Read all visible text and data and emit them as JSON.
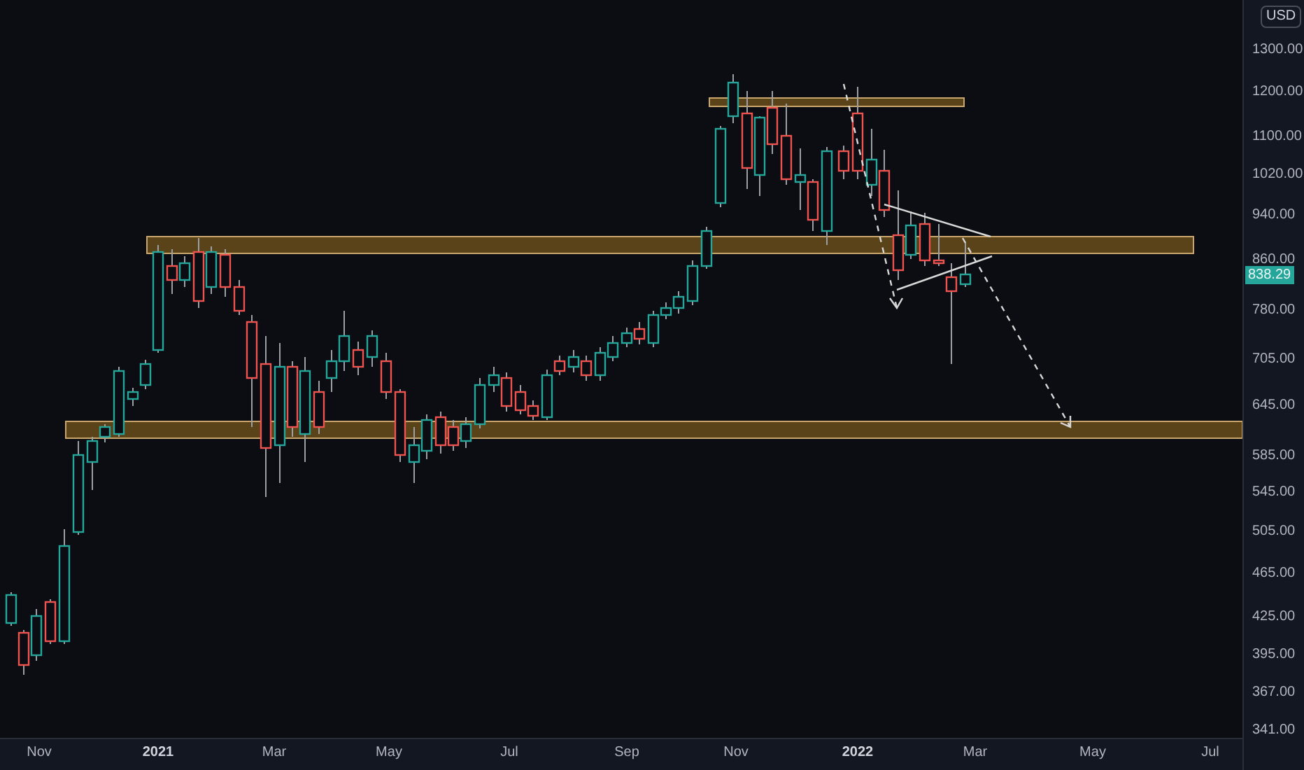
{
  "price_axis": {
    "currency": "USD",
    "last_price": "838.29",
    "labels": [
      {
        "text": "1300.00"
      },
      {
        "text": "1200.00"
      },
      {
        "text": "1100.00"
      },
      {
        "text": "1020.00"
      },
      {
        "text": "940.00"
      },
      {
        "text": "860.00"
      },
      {
        "text": "780.00"
      },
      {
        "text": "705.00"
      },
      {
        "text": "645.00"
      },
      {
        "text": "585.00"
      },
      {
        "text": "545.00"
      },
      {
        "text": "505.00"
      },
      {
        "text": "465.00"
      },
      {
        "text": "425.00"
      },
      {
        "text": "395.00"
      },
      {
        "text": "367.00"
      },
      {
        "text": "341.00"
      }
    ]
  },
  "time_axis": {
    "labels": [
      {
        "text": "Nov",
        "kind": "month"
      },
      {
        "text": "2021",
        "kind": "year"
      },
      {
        "text": "Mar",
        "kind": "month"
      },
      {
        "text": "May",
        "kind": "month"
      },
      {
        "text": "Jul",
        "kind": "month"
      },
      {
        "text": "Sep",
        "kind": "month"
      },
      {
        "text": "Nov",
        "kind": "month"
      },
      {
        "text": "2022",
        "kind": "year"
      },
      {
        "text": "Mar",
        "kind": "month"
      },
      {
        "text": "May",
        "kind": "month"
      },
      {
        "text": "Jul",
        "kind": "month"
      }
    ]
  }
}
